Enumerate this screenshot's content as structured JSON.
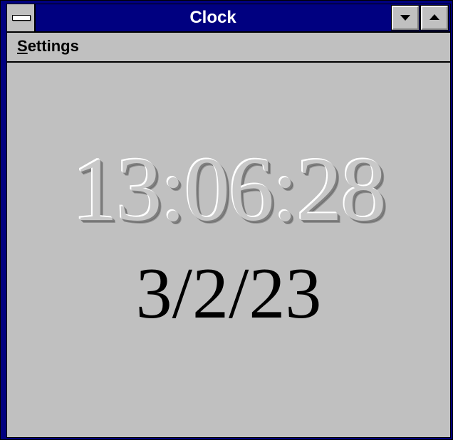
{
  "window": {
    "title": "Clock"
  },
  "menubar": {
    "settings_accel": "S",
    "settings_rest": "ettings"
  },
  "clock": {
    "time": "13:06:28",
    "date": "3/2/23"
  },
  "colors": {
    "titlebar": "#000080",
    "client_background": "#c0c0c0",
    "title_text": "#ffffff",
    "date_text": "#000000"
  },
  "icons": {
    "system_menu": "system-menu-icon",
    "minimize": "minimize-arrow-icon",
    "maximize": "maximize-arrow-icon"
  }
}
